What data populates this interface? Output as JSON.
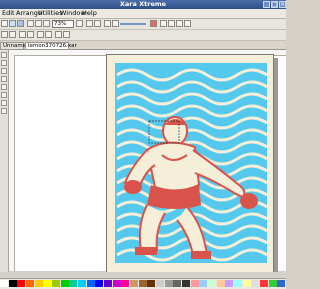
{
  "window": {
    "title": "Xara Xtreme"
  },
  "menu": {
    "items": [
      "Edit",
      "Arrange",
      "Utilities",
      "Window",
      "Help"
    ]
  },
  "toolbar": {
    "zoom_value": "73%"
  },
  "tabs": [
    {
      "label": "Unnamed1"
    },
    {
      "label": "lemon370726.xar"
    }
  ],
  "artwork": {
    "colors": {
      "cyan": "#55c8ee",
      "red": "#d9534a",
      "cream": "#f5eed8",
      "dark": "#222222"
    }
  },
  "palette": {
    "colors": [
      "#ffffff",
      "#000000",
      "#ff0000",
      "#ff6600",
      "#ffcc00",
      "#ffff00",
      "#99cc00",
      "#00cc00",
      "#00cc99",
      "#00ccff",
      "#0066ff",
      "#0000ff",
      "#6600cc",
      "#cc00cc",
      "#ff0099",
      "#cc9966",
      "#996633",
      "#663300",
      "#cccccc",
      "#999999",
      "#666666",
      "#333333",
      "#ff9999",
      "#99ccff",
      "#ccffcc",
      "#ffcc99",
      "#cc99ff",
      "#99ffff",
      "#ffff99",
      "#e0e0e0",
      "#ff3333",
      "#33cc33",
      "#3366cc"
    ]
  }
}
